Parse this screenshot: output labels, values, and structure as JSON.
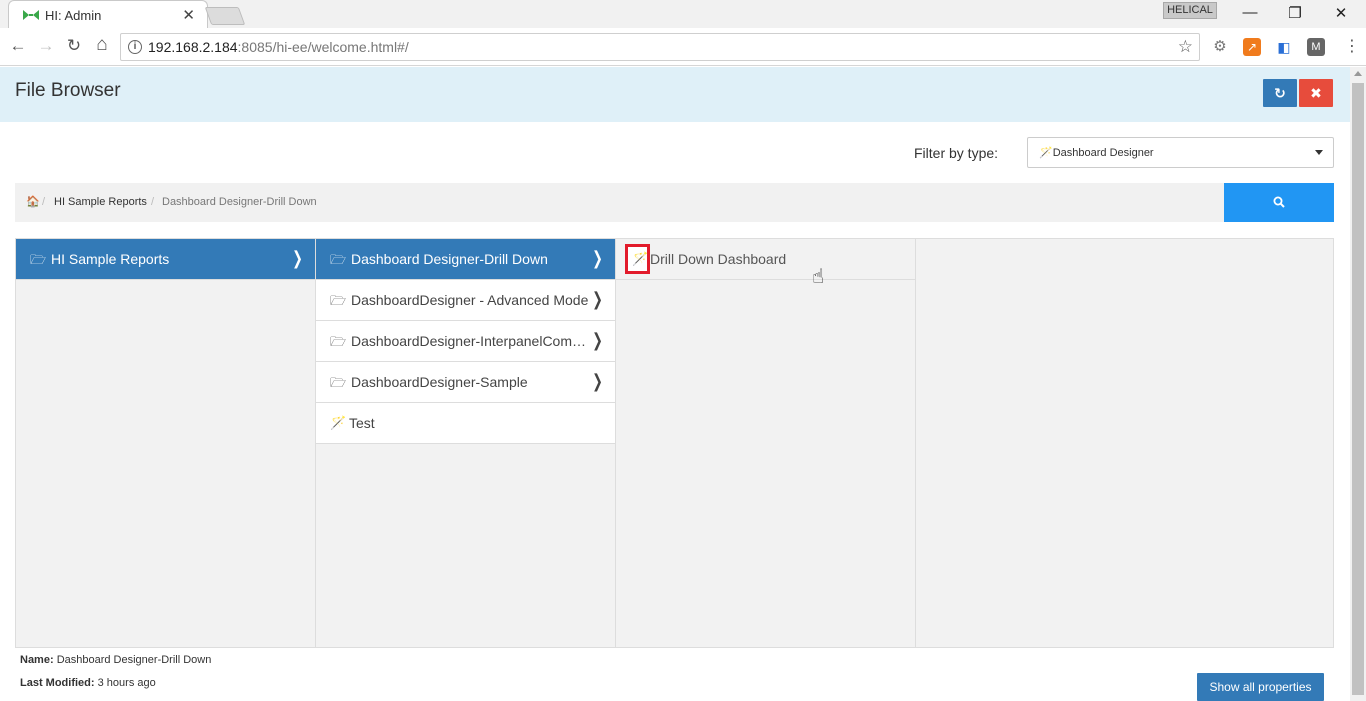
{
  "browser": {
    "tab_title": "HI: Admin",
    "close_tab": "✕",
    "profile": "HELICAL",
    "window": {
      "minimize": "—",
      "restore": "❐",
      "close": "✕"
    },
    "nav": {
      "back": "←",
      "forward": "→",
      "reload": "↻",
      "home": "⌂"
    },
    "url_host": "192.168.2.184",
    "url_rest": ":8085/hi-ee/welcome.html#/",
    "star": "☆",
    "menu": "⋮",
    "extensions": [
      "gear-ext-icon",
      "chart-ext-icon",
      "puzzle-ext-icon",
      "m-ext-icon"
    ]
  },
  "app": {
    "title": "File Browser",
    "refresh_icon": "↻",
    "close_icon": "✖",
    "filter": {
      "label": "Filter by type:",
      "selected": "Dashboard Designer",
      "icon": "⁄"
    },
    "breadcrumb": {
      "home_icon": "⌂",
      "sep": "/",
      "items": [
        "HI Sample Reports",
        "Dashboard Designer-Drill Down"
      ]
    },
    "search_icon": "🔍",
    "columns": [
      {
        "items": [
          {
            "type": "folder",
            "label": "HI Sample Reports",
            "selected": true,
            "chevron": "❯"
          }
        ]
      },
      {
        "items": [
          {
            "type": "folder",
            "label": "Dashboard Designer-Drill Down",
            "selected": true,
            "chevron": "❯"
          },
          {
            "type": "folder",
            "label": "DashboardDesigner - Advanced Mode",
            "selected": false,
            "chevron": "❯"
          },
          {
            "type": "folder",
            "label": "DashboardDesigner-InterpanelComm...",
            "selected": false,
            "chevron": "❯"
          },
          {
            "type": "folder",
            "label": "DashboardDesigner-Sample",
            "selected": false,
            "chevron": "❯"
          },
          {
            "type": "file",
            "label": "Test"
          }
        ]
      },
      {
        "items": [
          {
            "type": "file",
            "label": "Drill Down Dashboard"
          }
        ]
      }
    ],
    "details": {
      "name_label": "Name:",
      "name_value": "Dashboard Designer-Drill Down",
      "modified_label": "Last Modified:",
      "modified_value": "3 hours ago"
    },
    "show_props": "Show all properties"
  },
  "colors": {
    "header_bg": "#dff0f8",
    "primary": "#337ab7",
    "danger": "#e74c3c",
    "search": "#2196f3",
    "highlight_box": "#e21b2b"
  }
}
